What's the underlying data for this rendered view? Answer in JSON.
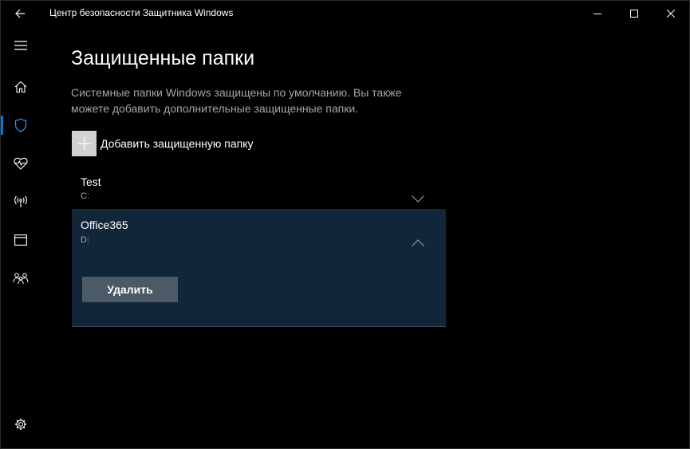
{
  "titlebar": {
    "app_title": "Центр безопасности Защитника Windows",
    "back_icon": "back-arrow-icon",
    "controls": [
      "minimize",
      "maximize",
      "close"
    ]
  },
  "nav": {
    "items": [
      {
        "icon": "hamburger-menu-icon"
      },
      {
        "icon": "home-icon"
      },
      {
        "icon": "shield-icon",
        "active": true
      },
      {
        "icon": "heart-pulse-icon"
      },
      {
        "icon": "wireless-antenna-icon"
      },
      {
        "icon": "app-browser-icon"
      },
      {
        "icon": "family-icon"
      },
      {
        "icon": "gear-icon"
      }
    ],
    "accent_color": "#0078d7"
  },
  "main": {
    "title": "Защищенные папки",
    "description": "Системные папки Windows защищены по умолчанию. Вы также можете добавить дополнительные защищенные папки.",
    "add_label": "Добавить защищенную папку",
    "folders": [
      {
        "name": "Test",
        "path": "C:",
        "expanded": false
      },
      {
        "name": "Office365",
        "path": "D:",
        "expanded": true,
        "remove_label": "Удалить"
      }
    ]
  }
}
